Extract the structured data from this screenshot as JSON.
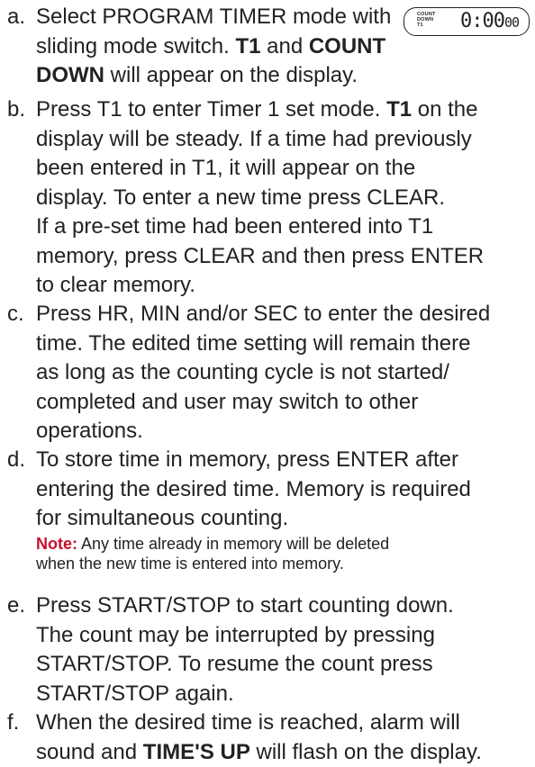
{
  "steps": [
    {
      "marker": "a.",
      "lines": [
        {
          "parts": [
            {
              "t": "Select PROGRAM TIMER mode with"
            }
          ]
        },
        {
          "parts": [
            {
              "t": "sliding mode switch. "
            },
            {
              "t": "T1",
              "b": true
            },
            {
              "t": " and "
            },
            {
              "t": "COUNT",
              "b": true
            }
          ]
        },
        {
          "parts": [
            {
              "t": "DOWN",
              "b": true
            },
            {
              "t": " will appear on the display."
            }
          ]
        }
      ]
    },
    {
      "marker": "b.",
      "lines": [
        {
          "parts": [
            {
              "t": "Press T1 to enter Timer 1 set mode. "
            },
            {
              "t": "T1",
              "b": true
            },
            {
              "t": " on the"
            }
          ]
        },
        {
          "parts": [
            {
              "t": "display will be steady. If a time had previously"
            }
          ]
        },
        {
          "parts": [
            {
              "t": "been entered in T1, it will appear on the"
            }
          ]
        },
        {
          "parts": [
            {
              "t": "display. To enter a new time press CLEAR."
            }
          ]
        },
        {
          "parts": [
            {
              "t": "If a pre-set time had been entered into T1"
            }
          ]
        },
        {
          "parts": [
            {
              "t": "memory, press CLEAR and then press ENTER"
            }
          ]
        },
        {
          "parts": [
            {
              "t": "to clear memory."
            }
          ]
        }
      ]
    },
    {
      "marker": "c.",
      "lines": [
        {
          "parts": [
            {
              "t": "Press HR, MIN and/or SEC to enter the desired"
            }
          ]
        },
        {
          "parts": [
            {
              "t": "time. The edited time setting will remain there"
            }
          ]
        },
        {
          "parts": [
            {
              "t": "as long as the counting cycle is not started/"
            }
          ]
        },
        {
          "parts": [
            {
              "t": "completed and user may switch to other"
            }
          ]
        },
        {
          "parts": [
            {
              "t": "operations."
            }
          ]
        }
      ]
    },
    {
      "marker": "d.",
      "lines": [
        {
          "parts": [
            {
              "t": "To store time in memory, press ENTER after"
            }
          ]
        },
        {
          "parts": [
            {
              "t": "entering the desired time. Memory is required"
            }
          ]
        },
        {
          "parts": [
            {
              "t": "for simultaneous counting."
            }
          ]
        }
      ],
      "note": {
        "label": "Note:",
        "lines": [
          "Any time already in memory will be deleted",
          "when the new time is entered into memory."
        ]
      }
    },
    {
      "marker": "e.",
      "lines": [
        {
          "parts": [
            {
              "t": "Press START/STOP to start counting down."
            }
          ]
        },
        {
          "parts": [
            {
              "t": "The count may be interrupted by pressing"
            }
          ]
        },
        {
          "parts": [
            {
              "t": "START/STOP. To resume the count press"
            }
          ]
        },
        {
          "parts": [
            {
              "t": "START/STOP again."
            }
          ]
        }
      ]
    },
    {
      "marker": "f.",
      "lines": [
        {
          "parts": [
            {
              "t": "When the desired time is reached, alarm will"
            }
          ]
        },
        {
          "parts": [
            {
              "t": "sound and "
            },
            {
              "t": "TIME'S UP",
              "b": true
            },
            {
              "t": " will flash on the display."
            }
          ]
        }
      ]
    }
  ],
  "display": {
    "labels": [
      "COUNT",
      "DOWN",
      "T1"
    ],
    "time_main": "0:00",
    "time_seconds": "00"
  },
  "colors": {
    "text": "#222222",
    "note_label": "#c8102e"
  }
}
